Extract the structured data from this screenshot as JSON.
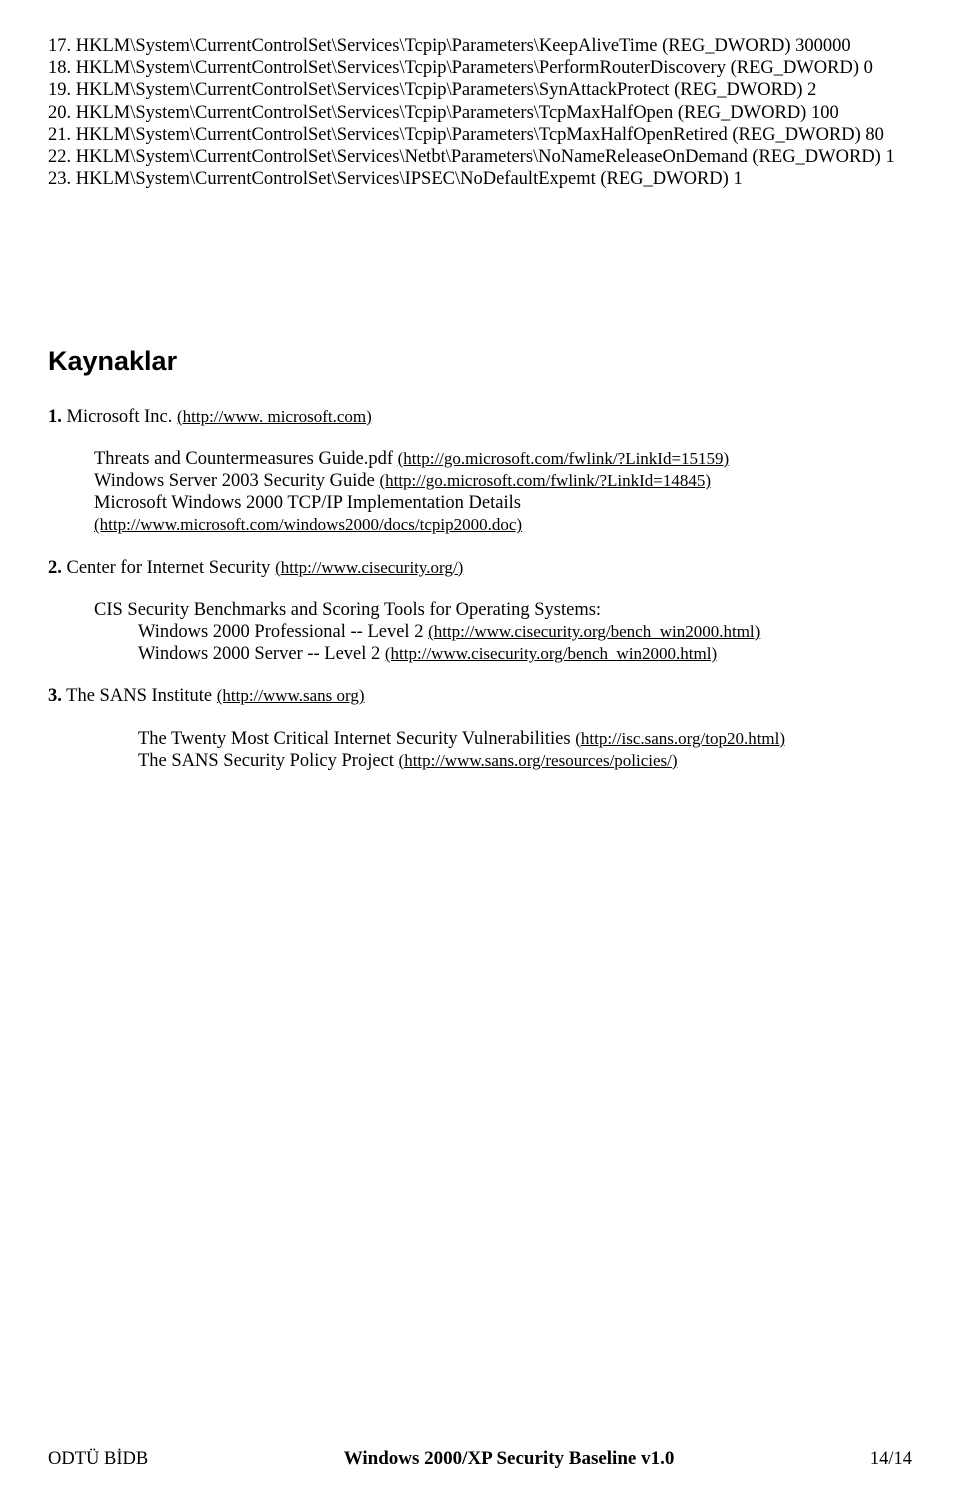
{
  "registry": [
    {
      "n": "17.",
      "text": "HKLM\\System\\CurrentControlSet\\Services\\Tcpip\\Parameters\\KeepAliveTime (REG_DWORD) 300000"
    },
    {
      "n": "18.",
      "text": "HKLM\\System\\CurrentControlSet\\Services\\Tcpip\\Parameters\\PerformRouterDiscovery (REG_DWORD) 0"
    },
    {
      "n": "19.",
      "text": "HKLM\\System\\CurrentControlSet\\Services\\Tcpip\\Parameters\\SynAttackProtect (REG_DWORD) 2"
    },
    {
      "n": "20.",
      "text": "HKLM\\System\\CurrentControlSet\\Services\\Tcpip\\Parameters\\TcpMaxHalfOpen (REG_DWORD) 100"
    },
    {
      "n": "21.",
      "text": "HKLM\\System\\CurrentControlSet\\Services\\Tcpip\\Parameters\\TcpMaxHalfOpenRetired (REG_DWORD) 80"
    },
    {
      "n": "22.",
      "text": "HKLM\\System\\CurrentControlSet\\Services\\Netbt\\Parameters\\NoNameReleaseOnDemand (REG_DWORD) 1"
    },
    {
      "n": "23.",
      "text": "HKLM\\System\\CurrentControlSet\\Services\\IPSEC\\NoDefaultExpemt (REG_DWORD) 1"
    }
  ],
  "heading": "Kaynaklar",
  "ref1": {
    "num": "1.",
    "vendor": "Microsoft Inc.",
    "url": "(http://www. microsoft.com)",
    "line1_a": "Threats and Countermeasures Guide.pdf ",
    "line1_b": "(http://go.microsoft.com/fwlink/?LinkId=15159)",
    "line2_a": "Windows Server 2003 Security Guide ",
    "line2_b": "(http://go.microsoft.com/fwlink/?LinkId=14845)",
    "line3": "Microsoft Windows 2000 TCP/IP Implementation Details",
    "line3_url": "(http://www.microsoft.com/windows2000/docs/tcpip2000.doc)"
  },
  "ref2": {
    "num": "2.",
    "vendor": "Center for Internet Security ",
    "url": "(http://www.cisecurity.org/)",
    "line1": "CIS Security Benchmarks and Scoring Tools for Operating Systems:",
    "line2_a": "Windows 2000 Professional -- Level 2 ",
    "line2_b": "(http://www.cisecurity.org/bench_win2000.html)",
    "line3_a": "Windows 2000 Server -- Level 2 ",
    "line3_b": "(http://www.cisecurity.org/bench_win2000.html)"
  },
  "ref3": {
    "num": "3.",
    "vendor": "The SANS Institute ",
    "url": "(http://www.sans org)",
    "line1_a": "The Twenty Most Critical Internet Security Vulnerabilities ",
    "line1_b": "(http://isc.sans.org/top20.html)",
    "line2_a": "The SANS Security Policy Project ",
    "line2_b": "(http://www.sans.org/resources/policies/)"
  },
  "footer": {
    "left": "ODTÜ BİDB",
    "center": "Windows 2000/XP Security Baseline v1.0",
    "right": "14/14"
  }
}
